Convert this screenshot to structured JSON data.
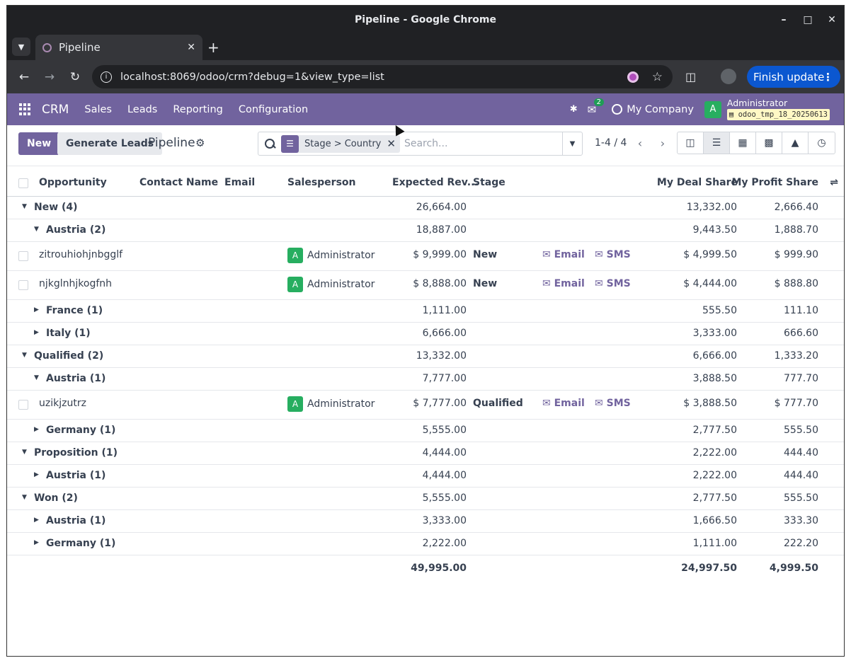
{
  "browser": {
    "window_title": "Pipeline - Google Chrome",
    "tab_title": "Pipeline",
    "url": "localhost:8069/odoo/crm?debug=1&view_type=list",
    "finish_update_label": "Finish update"
  },
  "odoo_nav": {
    "brand": "CRM",
    "menu": [
      "Sales",
      "Leads",
      "Reporting",
      "Configuration"
    ],
    "chat_badge": "2",
    "company": "My Company",
    "user_initial": "A",
    "user_name": "Administrator",
    "db_name": "odoo_tmp_18_20250613"
  },
  "control": {
    "new_label": "New",
    "generate_label": "Generate Leads",
    "title": "Pipeline",
    "facet_text": "Stage > Country",
    "search_placeholder": "Search...",
    "pager": "1-4 / 4"
  },
  "columns": {
    "opportunity": "Opportunity",
    "contact": "Contact Name",
    "email": "Email",
    "salesperson": "Salesperson",
    "revenue": "Expected Rev...",
    "stage": "Stage",
    "deal_share": "My Deal Share",
    "profit_share": "My Profit Share"
  },
  "rows": [
    {
      "kind": "group",
      "level": 0,
      "open": true,
      "label": "New (4)",
      "revenue": "26,664.00",
      "deal": "13,332.00",
      "profit": "2,666.40"
    },
    {
      "kind": "group",
      "level": 1,
      "open": true,
      "label": "Austria (2)",
      "revenue": "18,887.00",
      "deal": "9,443.50",
      "profit": "1,888.70"
    },
    {
      "kind": "record",
      "name": "zitrouhiohjnbgglf",
      "salesperson": "Administrator",
      "revenue": "$ 9,999.00",
      "stage": "New",
      "email_label": "Email",
      "sms_label": "SMS",
      "deal": "$ 4,999.50",
      "profit": "$ 999.90"
    },
    {
      "kind": "record",
      "name": "njkglnhjkogfnh",
      "salesperson": "Administrator",
      "revenue": "$ 8,888.00",
      "stage": "New",
      "email_label": "Email",
      "sms_label": "SMS",
      "deal": "$ 4,444.00",
      "profit": "$ 888.80"
    },
    {
      "kind": "group",
      "level": 1,
      "open": false,
      "label": "France (1)",
      "revenue": "1,111.00",
      "deal": "555.50",
      "profit": "111.10"
    },
    {
      "kind": "group",
      "level": 1,
      "open": false,
      "label": "Italy (1)",
      "revenue": "6,666.00",
      "deal": "3,333.00",
      "profit": "666.60"
    },
    {
      "kind": "group",
      "level": 0,
      "open": true,
      "label": "Qualified (2)",
      "revenue": "13,332.00",
      "deal": "6,666.00",
      "profit": "1,333.20"
    },
    {
      "kind": "group",
      "level": 1,
      "open": true,
      "label": "Austria (1)",
      "revenue": "7,777.00",
      "deal": "3,888.50",
      "profit": "777.70"
    },
    {
      "kind": "record",
      "name": "uzikjzutrz",
      "salesperson": "Administrator",
      "revenue": "$ 7,777.00",
      "stage": "Qualified",
      "email_label": "Email",
      "sms_label": "SMS",
      "deal": "$ 3,888.50",
      "profit": "$ 777.70"
    },
    {
      "kind": "group",
      "level": 1,
      "open": false,
      "label": "Germany (1)",
      "revenue": "5,555.00",
      "deal": "2,777.50",
      "profit": "555.50"
    },
    {
      "kind": "group",
      "level": 0,
      "open": true,
      "label": "Proposition (1)",
      "revenue": "4,444.00",
      "deal": "2,222.00",
      "profit": "444.40"
    },
    {
      "kind": "group",
      "level": 1,
      "open": false,
      "label": "Austria (1)",
      "revenue": "4,444.00",
      "deal": "2,222.00",
      "profit": "444.40"
    },
    {
      "kind": "group",
      "level": 0,
      "open": true,
      "label": "Won (2)",
      "revenue": "5,555.00",
      "deal": "2,777.50",
      "profit": "555.50"
    },
    {
      "kind": "group",
      "level": 1,
      "open": false,
      "label": "Austria (1)",
      "revenue": "3,333.00",
      "deal": "1,666.50",
      "profit": "333.30"
    },
    {
      "kind": "group",
      "level": 1,
      "open": false,
      "label": "Germany (1)",
      "revenue": "2,222.00",
      "deal": "1,111.00",
      "profit": "222.20"
    }
  ],
  "totals": {
    "revenue": "49,995.00",
    "deal": "24,997.50",
    "profit": "4,999.50"
  },
  "colors": {
    "brand": "#71639e",
    "avatar": "#27ae60"
  }
}
